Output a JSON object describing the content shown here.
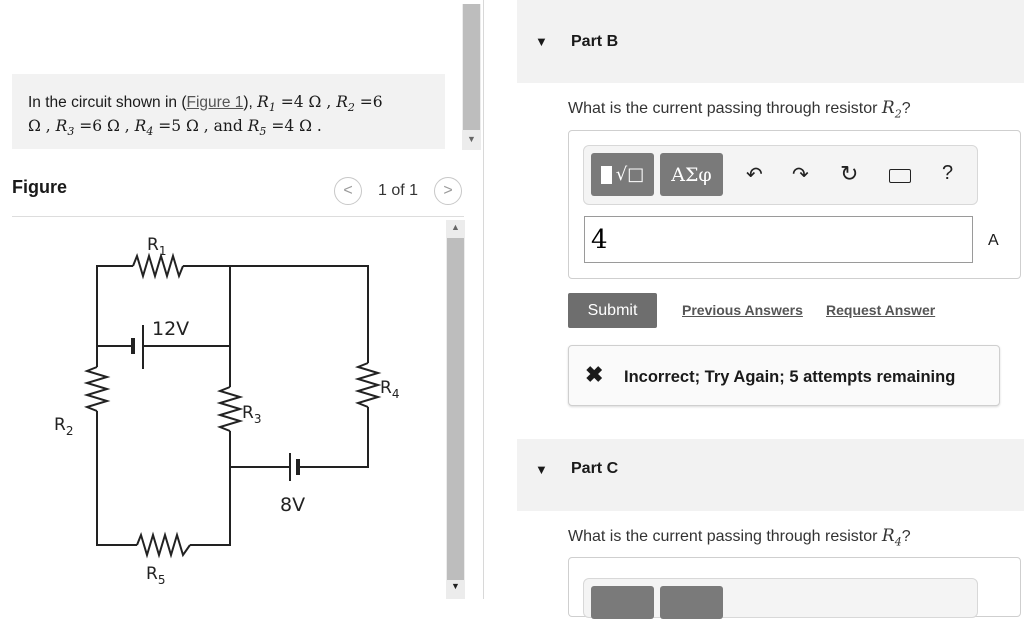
{
  "problem": {
    "prefix": "In the circuit shown in (",
    "figure_link": "Figure 1",
    "suffix": "),",
    "r1": "R",
    "r1_sub": "1",
    "r1_val": " =4 Ω , ",
    "r2": "R",
    "r2_sub": "2",
    "r2_val": " =6",
    "line2_a": "Ω , ",
    "r3": "R",
    "r3_sub": "3",
    "r3_val": " =6 Ω , ",
    "r4": "R",
    "r4_sub": "4",
    "r4_val": " =5 Ω , and ",
    "r5": "R",
    "r5_sub": "5",
    "r5_val": " =4 Ω ."
  },
  "figure": {
    "title": "Figure",
    "page_indicator": "1 of 1",
    "prev_icon": "chevron-left-icon",
    "next_icon": "chevron-right-icon"
  },
  "circuit": {
    "labels": {
      "r1": "R1",
      "r2": "R2",
      "r3": "R3",
      "r4": "R4",
      "r5": "R5",
      "battery1": "12V",
      "battery2": "8V"
    }
  },
  "part_b": {
    "title": "Part B",
    "question_prefix": "What is the current passing through resistor ",
    "question_var": "R",
    "question_sub": "2",
    "question_suffix": "?",
    "toolbar": {
      "template_label": "√□",
      "symbols_label": "ΑΣφ",
      "undo_icon": "undo-icon",
      "redo_icon": "redo-icon",
      "reset_icon": "reset-icon",
      "keyboard_icon": "keyboard-icon",
      "help_label": "?"
    },
    "answer_value": "4",
    "unit": "A",
    "submit_label": "Submit",
    "previous_answers_label": "Previous Answers",
    "request_answer_label": "Request Answer",
    "feedback": "Incorrect; Try Again; 5 attempts remaining"
  },
  "part_c": {
    "title": "Part C",
    "question_prefix": "What is the current passing through resistor ",
    "question_var": "R",
    "question_sub": "4",
    "question_suffix": "?"
  },
  "colors": {
    "panel_bg": "#f2f2f2",
    "button_gray": "#6e6e6e",
    "border": "#cfcfcf"
  }
}
